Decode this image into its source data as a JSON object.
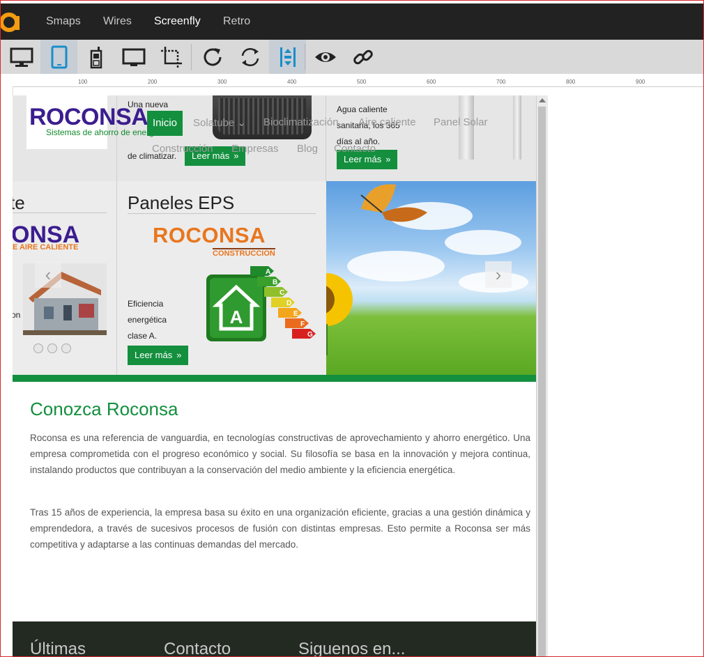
{
  "topnav": {
    "logo_icon": "screenfly-logo-icon",
    "links": [
      {
        "label": "Smaps"
      },
      {
        "label": "Wires"
      },
      {
        "label": "Screenfly",
        "active": true
      },
      {
        "label": "Retro"
      }
    ]
  },
  "toolbar": {
    "buttons": [
      "desktop-icon",
      "tablet-icon",
      "mobile-phone-icon",
      "television-icon",
      "crop-icon",
      "refresh-icon",
      "rotate-icon",
      "scroll-toggle-icon",
      "preview-eye-icon",
      "share-link-icon"
    ],
    "active": "tablet-icon"
  },
  "ruler": {
    "labels": [
      "100",
      "200",
      "300",
      "400",
      "500",
      "600",
      "700",
      "800",
      "900"
    ]
  },
  "site": {
    "brand": {
      "name": "ROCONSA",
      "tagline": "Sistemas de ahorro de energía"
    },
    "menu": {
      "active": "Inicio",
      "row1": [
        "Solatube ⌄",
        "Bioclimatización",
        "Aire caliente",
        "Panel Solar"
      ],
      "row2": [
        "Construcción",
        "Empresas",
        "Blog",
        "Contacto"
      ]
    },
    "feature_top": {
      "col2_text": [
        "Una nueva",
        "de climatizar."
      ],
      "col3_text": [
        "Agua caliente",
        "sanitaria, los 365",
        "días al año."
      ],
      "button_label": "Leer más"
    },
    "feature_mid": {
      "col1_title": "te",
      "col1_logo": "ONSA",
      "col1_logo_sub": "E AIRE CALIENTE",
      "col1_text": "on",
      "col2_title": "Paneles EPS",
      "col2_logo": "ROCONSA",
      "col2_logo_sub": "CONSTRUCCION",
      "col2_text": [
        "Eficiencia",
        "energética",
        "clase A."
      ],
      "energy_letters": [
        "A",
        "B",
        "C",
        "D",
        "E",
        "F",
        "G"
      ],
      "energy_badge": "A",
      "button_label": "Leer más",
      "prev_label": "‹",
      "next_label": "›"
    },
    "about": {
      "title": "Conozca Roconsa",
      "p1": "Roconsa es una referencia de vanguardia, en tecnologías constructivas de aprovechamiento y ahorro energético. Una empresa comprometida con el progreso económico y social. Su filosofía se basa en la innovación y mejora continua, instalando productos que contribuyan a la conservación del medio ambiente y la eficiencia energética.",
      "p2": "Tras 15 años de experiencia, la empresa basa su éxito en una organización eficiente, gracias a una gestión dinámica y emprendedora, a través de sucesivos procesos de fusión con distintas empresas. Esto permite a Roconsa ser más competitiva y adaptarse a las continuas demandas del mercado."
    },
    "footer": {
      "col1": "Últimas",
      "col2": "Contacto",
      "col3": "Siguenos en..."
    }
  },
  "colors": {
    "topnav_bg": "#222222",
    "toolbar_bg": "#d9d9d9",
    "brand_green": "#138f3e",
    "brand_purple": "#3b1d8f",
    "orange": "#e8761e"
  }
}
